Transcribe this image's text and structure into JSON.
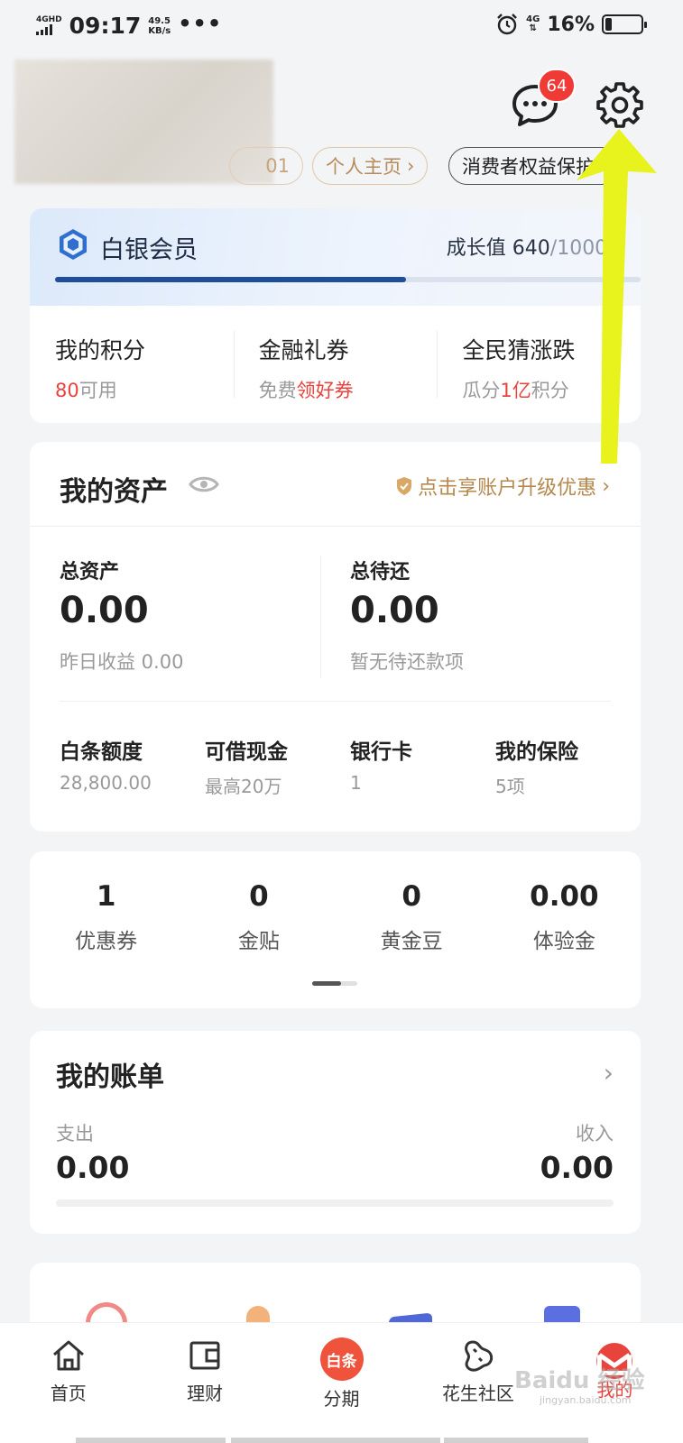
{
  "status_bar": {
    "network": "4GHD",
    "time": "09:17",
    "speed_value": "49.5",
    "speed_unit": "KB/s",
    "more": "•••",
    "net_right": "4G",
    "battery": "16%",
    "battery_level": 0.16
  },
  "header": {
    "chip_hidden": "01",
    "chip_profile": "个人主页",
    "chip_protect": "消费者权益保护",
    "message_badge": "64"
  },
  "member": {
    "title": "白银会员",
    "growth_label": "成长值",
    "growth_value": "640",
    "growth_max": "/1000",
    "progress": 0.6,
    "cols": [
      {
        "title": "我的积分",
        "pre": "",
        "hl": "80",
        "post": "可用"
      },
      {
        "title": "金融礼券",
        "pre": "免费",
        "hl": "领好券",
        "post": ""
      },
      {
        "title": "全民猜涨跌",
        "pre": "瓜分",
        "hl": "1亿",
        "post": "积分"
      }
    ]
  },
  "assets": {
    "title": "我的资产",
    "upgrade": "点击享账户升级优惠",
    "total_label": "总资产",
    "total_value": "0.00",
    "total_sub": "昨日收益 0.00",
    "repay_label": "总待还",
    "repay_value": "0.00",
    "repay_sub": "暂无待还款项",
    "items": [
      {
        "title": "白条额度",
        "sub": "28,800.00"
      },
      {
        "title": "可借现金",
        "sub": "最高20万"
      },
      {
        "title": "银行卡",
        "sub": "1"
      },
      {
        "title": "我的保险",
        "sub": "5项"
      }
    ]
  },
  "wallet": [
    {
      "num": "1",
      "label": "优惠券"
    },
    {
      "num": "0",
      "label": "金贴"
    },
    {
      "num": "0",
      "label": "黄金豆"
    },
    {
      "num": "0.00",
      "label": "体验金"
    }
  ],
  "bill": {
    "title": "我的账单",
    "out_label": "支出",
    "out_value": "0.00",
    "in_label": "收入",
    "in_value": "0.00"
  },
  "nav": [
    {
      "label": "首页",
      "icon": "home-icon"
    },
    {
      "label": "理财",
      "icon": "wallet-icon"
    },
    {
      "label": "分期",
      "icon": "baitiao-icon",
      "badge": "白条"
    },
    {
      "label": "花生社区",
      "icon": "peanut-icon"
    },
    {
      "label": "我的",
      "icon": "mine-icon"
    }
  ],
  "watermark": {
    "logo": "Baidu 经验",
    "url": "jingyan.baidu.com"
  },
  "colors": {
    "accent_red": "#e8433d",
    "member_blue": "#1e4e99",
    "gold": "#b6884e",
    "arrow_yellow": "#e8f21c"
  }
}
